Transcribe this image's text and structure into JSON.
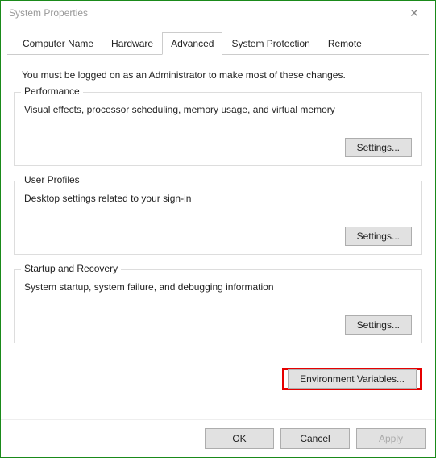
{
  "window": {
    "title": "System Properties"
  },
  "tabs": {
    "computer_name": "Computer Name",
    "hardware": "Hardware",
    "advanced": "Advanced",
    "system_protection": "System Protection",
    "remote": "Remote"
  },
  "intro": "You must be logged on as an Administrator to make most of these changes.",
  "groups": {
    "performance": {
      "label": "Performance",
      "desc": "Visual effects, processor scheduling, memory usage, and virtual memory",
      "settings_btn": "Settings..."
    },
    "user_profiles": {
      "label": "User Profiles",
      "desc": "Desktop settings related to your sign-in",
      "settings_btn": "Settings..."
    },
    "startup_recovery": {
      "label": "Startup and Recovery",
      "desc": "System startup, system failure, and debugging information",
      "settings_btn": "Settings..."
    }
  },
  "env_btn": "Environment Variables...",
  "dialog_buttons": {
    "ok": "OK",
    "cancel": "Cancel",
    "apply": "Apply"
  }
}
